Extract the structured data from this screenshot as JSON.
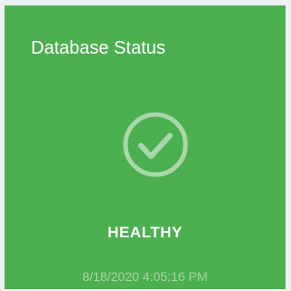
{
  "tile": {
    "title": "Database Status",
    "icon": "check-circle-icon",
    "status": "HEALTHY",
    "timestamp": "8/18/2020 4:05:16 PM",
    "colors": {
      "background": "#4caf50",
      "icon": "#a9d7aa",
      "text": "#ffffff",
      "timestamp": "#a9d7aa",
      "page": "#eef1f4"
    }
  }
}
